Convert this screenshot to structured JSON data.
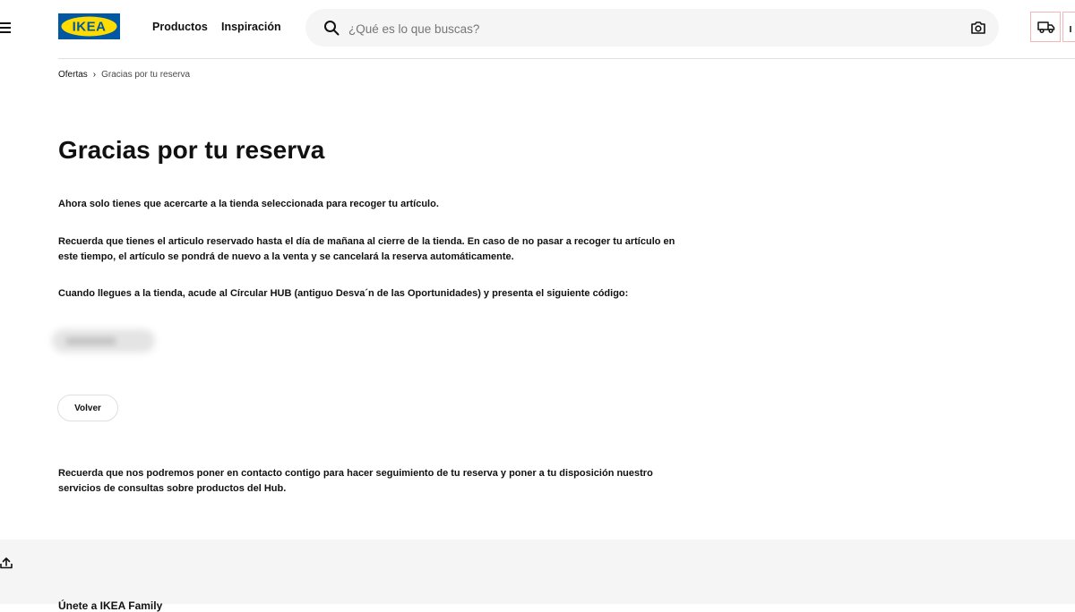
{
  "header": {
    "logo_text": "IKEA",
    "nav": [
      "Productos",
      "Inspiración"
    ],
    "search": {
      "placeholder": "¿Qué es lo que buscas?"
    }
  },
  "breadcrumb": {
    "parent": "Ofertas",
    "separator": "›",
    "current": "Gracias por tu reserva"
  },
  "main": {
    "title": "Gracias por tu reserva",
    "paragraphs": [
      "Ahora solo tienes que acercarte a la tienda seleccionada para recoger tu artículo.",
      "Recuerda que tienes el articulo reservado hasta el día de mañana al cierre de la tienda. En caso de no pasar a recoger tu artículo en este tiempo, el artículo se pondrá de nuevo a la venta y se cancelará la reserva automáticamente.",
      "Cuando llegues a la tienda, acude al Círcular HUB (antiguo Desva´n de las Oportunidades) y presenta el siguiente código:",
      "Recuerda que nos podremos poner en contacto contigo para hacer seguimiento de tu reserva y poner a tu disposición nuestro servicios de consultas sobre productos del Hub."
    ],
    "back_button": "Volver"
  },
  "footer": {
    "heading": "Únete a IKEA Family"
  },
  "colors": {
    "ikea_blue": "#0058a3",
    "ikea_yellow": "#ffdb00",
    "footer_bg": "#f5f5f5",
    "search_bg": "#f5f5f5"
  }
}
